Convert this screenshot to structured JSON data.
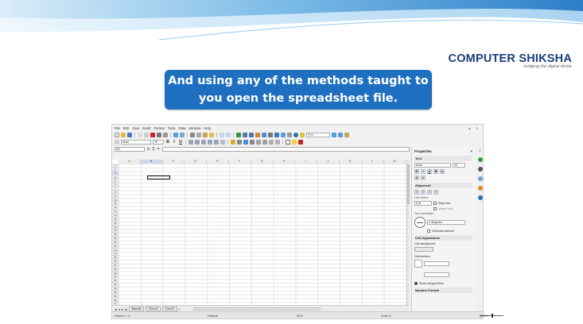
{
  "logo": {
    "name": "COMPUTER SHIKSHA",
    "tagline": "bridging the digital divide"
  },
  "banner": {
    "line1": "And using any of the methods taught to",
    "line2": "you open the spreadsheet file."
  },
  "menu": [
    "File",
    "Edit",
    "View",
    "Insert",
    "Format",
    "Tools",
    "Data",
    "Window",
    "Help"
  ],
  "toolbar": {
    "find_placeholder": "Find"
  },
  "format_bar": {
    "font_name": "Arial",
    "font_size": "10",
    "bold": "B",
    "italic": "I",
    "underline": "U"
  },
  "formula_bar": {
    "name_box": "B3",
    "fx": "fx",
    "sum": "Σ",
    "equals": "="
  },
  "columns": [
    "A",
    "B",
    "C",
    "D",
    "E",
    "F",
    "G",
    "H",
    "I",
    "J",
    "K",
    "L",
    "M"
  ],
  "rows": [
    "1",
    "2",
    "3",
    "4",
    "5",
    "6",
    "7",
    "8",
    "9",
    "10",
    "11",
    "12",
    "13",
    "14",
    "15",
    "16",
    "17",
    "18",
    "19",
    "20",
    "21",
    "22",
    "23",
    "24",
    "25",
    "26",
    "27",
    "28",
    "29",
    "30",
    "31",
    "32",
    "33",
    "34",
    "35",
    "36",
    "37"
  ],
  "sheet_tabs": [
    "Sheet1",
    "Sheet2",
    "Sheet3"
  ],
  "status": {
    "sheet": "Sheet 1 / 3",
    "style": "Default",
    "std": "STD",
    "sum": "Sum=0",
    "zoom": "100%"
  },
  "sidebar": {
    "title": "Properties",
    "text_section": "Text",
    "font_name": "Arial",
    "font_size": "10",
    "alignment_section": "Alignment",
    "indent_label": "Left indent:",
    "indent_value": "0 pt",
    "wrap_text": "Wrap text",
    "merge_cells": "Merge cells",
    "orientation_label": "Text orientation:",
    "degrees_value": "0 degrees",
    "vertically_stacked": "Vertically stacked",
    "cell_appearance_section": "Cell Appearance",
    "cell_background_label": "Cell background:",
    "cell_borders_label": "Cell borders:",
    "show_grid": "Show cell grid lines",
    "number_format_section": "Number Format"
  },
  "colors": {
    "banner": "#1f6fc0",
    "logo_dark": "#1a3f7a",
    "logo_accent": "#c8232b",
    "selection": "#cfd9ee"
  }
}
